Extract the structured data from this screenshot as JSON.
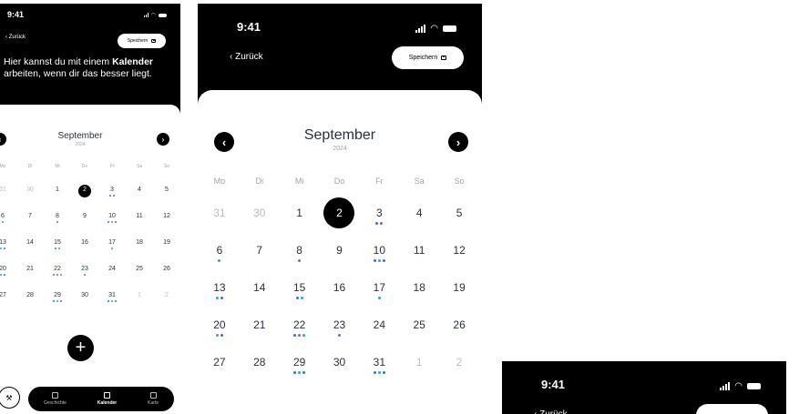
{
  "status": {
    "time": "9:41"
  },
  "nav": {
    "back_label": "Zurück",
    "save_label": "Speichern"
  },
  "intro": {
    "text_pre": "Hier kannst du mit einem ",
    "text_bold": "Kalender",
    "text_post": " arbeiten, wenn dir das besser liegt."
  },
  "calendar": {
    "month": "September",
    "year": "2024",
    "weekdays": [
      "Mo",
      "Di",
      "Mi",
      "Do",
      "Fr",
      "Sa",
      "So"
    ],
    "days": [
      {
        "n": "31",
        "muted": true,
        "dots": []
      },
      {
        "n": "30",
        "muted": true,
        "dots": []
      },
      {
        "n": "1",
        "dots": []
      },
      {
        "n": "2",
        "sel": true,
        "dots": []
      },
      {
        "n": "3",
        "dots": [
          "#3b6cf0",
          "#a34ad8"
        ]
      },
      {
        "n": "4",
        "dots": []
      },
      {
        "n": "5",
        "dots": []
      },
      {
        "n": "6",
        "dots": [
          "#1fb59b"
        ]
      },
      {
        "n": "7",
        "dots": []
      },
      {
        "n": "8",
        "dots": [
          "#a34ad8"
        ]
      },
      {
        "n": "9",
        "dots": []
      },
      {
        "n": "10",
        "dots": [
          "#3b6cf0",
          "#1fb59b",
          "#3b6cf0"
        ]
      },
      {
        "n": "11",
        "dots": []
      },
      {
        "n": "12",
        "dots": []
      },
      {
        "n": "13",
        "dots": [
          "#1fb59b",
          "#3b6cf0"
        ]
      },
      {
        "n": "14",
        "dots": []
      },
      {
        "n": "15",
        "dots": [
          "#3b6cf0",
          "#1fb59b"
        ]
      },
      {
        "n": "16",
        "dots": []
      },
      {
        "n": "17",
        "dots": [
          "#1fb59b"
        ]
      },
      {
        "n": "18",
        "dots": []
      },
      {
        "n": "19",
        "dots": []
      },
      {
        "n": "20",
        "dots": [
          "#1fb59b",
          "#3b6cf0"
        ]
      },
      {
        "n": "21",
        "dots": []
      },
      {
        "n": "22",
        "dots": [
          "#3b6cf0",
          "#a34ad8",
          "#1fb59b"
        ]
      },
      {
        "n": "23",
        "dots": [
          "#a34ad8"
        ]
      },
      {
        "n": "24",
        "dots": []
      },
      {
        "n": "25",
        "dots": []
      },
      {
        "n": "26",
        "dots": []
      },
      {
        "n": "27",
        "dots": []
      },
      {
        "n": "28",
        "dots": []
      },
      {
        "n": "29",
        "dots": [
          "#3b6cf0",
          "#1fb59b",
          "#3b6cf0"
        ]
      },
      {
        "n": "30",
        "dots": []
      },
      {
        "n": "31",
        "dots": [
          "#3b6cf0",
          "#1fb59b",
          "#3b6cf0"
        ]
      },
      {
        "n": "1",
        "muted": true,
        "dots": []
      },
      {
        "n": "2",
        "muted": true,
        "dots": []
      }
    ]
  },
  "tabbar": {
    "items": [
      {
        "label": "Geschichte",
        "icon": "story-icon"
      },
      {
        "label": "Kalender",
        "icon": "calendar-icon",
        "active": true
      },
      {
        "label": "Karte",
        "icon": "map-icon"
      }
    ]
  },
  "colors": {
    "dark": "#000000",
    "text": "#2b2f3e",
    "muted": "#b8bdc8",
    "dot_blue": "#3b6cf0",
    "dot_teal": "#1fb59b",
    "dot_purple": "#a34ad8"
  }
}
